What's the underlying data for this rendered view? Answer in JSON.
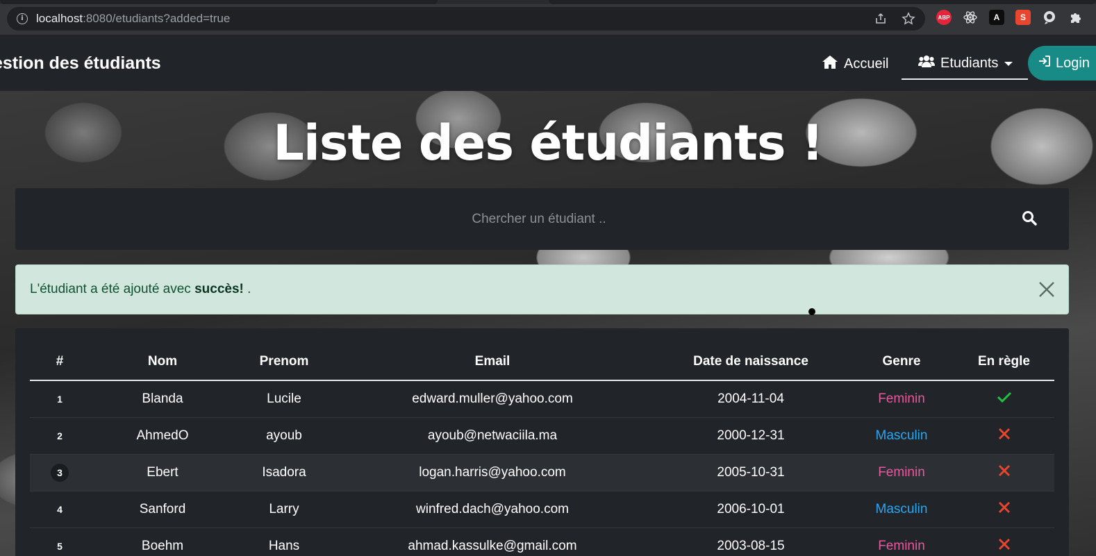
{
  "browser": {
    "url_host": "localhost",
    "url_rest": ":8080/etudiants?added=true",
    "extensions": [
      {
        "name": "abp",
        "label": "ABP",
        "color": "#e3263a"
      },
      {
        "name": "react",
        "label": "",
        "color": "#35363a"
      },
      {
        "name": "angular",
        "label": "A",
        "color": "#0d0d0d"
      },
      {
        "name": "ext-s",
        "label": "S",
        "color": "#e8462f"
      },
      {
        "name": "chat",
        "label": "",
        "color": "#35363a"
      },
      {
        "name": "puzzle",
        "label": "",
        "color": "#35363a"
      }
    ]
  },
  "navbar": {
    "brand": "estion des étudiants",
    "home_label": "Accueil",
    "students_label": "Etudiants",
    "login_label": "Login"
  },
  "hero": {
    "title": "Liste des étudiants !"
  },
  "search": {
    "placeholder": "Chercher un étudiant .."
  },
  "alert": {
    "text_before": "L'étudiant a été ajouté avec ",
    "text_bold": "succès!",
    "text_after": " ."
  },
  "table": {
    "headers": [
      "#",
      "Nom",
      "Prenom",
      "Email",
      "Date de naissance",
      "Genre",
      "En règle"
    ],
    "rows": [
      {
        "id": "1",
        "nom": "Blanda",
        "prenom": "Lucile",
        "email": "edward.muller@yahoo.com",
        "date": "2004-11-04",
        "genre": "Feminin",
        "en_regle": true
      },
      {
        "id": "2",
        "nom": "AhmedO",
        "prenom": "ayoub",
        "email": "ayoub@netwaciila.ma",
        "date": "2000-12-31",
        "genre": "Masculin",
        "en_regle": false
      },
      {
        "id": "3",
        "nom": "Ebert",
        "prenom": "Isadora",
        "email": "logan.harris@yahoo.com",
        "date": "2005-10-31",
        "genre": "Feminin",
        "en_regle": false
      },
      {
        "id": "4",
        "nom": "Sanford",
        "prenom": "Larry",
        "email": "winfred.dach@yahoo.com",
        "date": "2006-10-01",
        "genre": "Masculin",
        "en_regle": false
      },
      {
        "id": "5",
        "nom": "Boehm",
        "prenom": "Hans",
        "email": "ahmad.kassulke@gmail.com",
        "date": "2003-08-15",
        "genre": "Feminin",
        "en_regle": false
      }
    ]
  },
  "colors": {
    "feminin": "#e8589e",
    "masculin": "#2ba6f0",
    "check": "#20c040",
    "cross": "#e8452f",
    "alert_bg": "#d1e7dd",
    "login_bg": "#198b87"
  },
  "icons": {
    "home": "home-icon",
    "users": "users-icon",
    "login": "login-icon",
    "search": "search-icon",
    "close": "close-icon",
    "check": "check-icon",
    "cross": "cross-icon"
  }
}
